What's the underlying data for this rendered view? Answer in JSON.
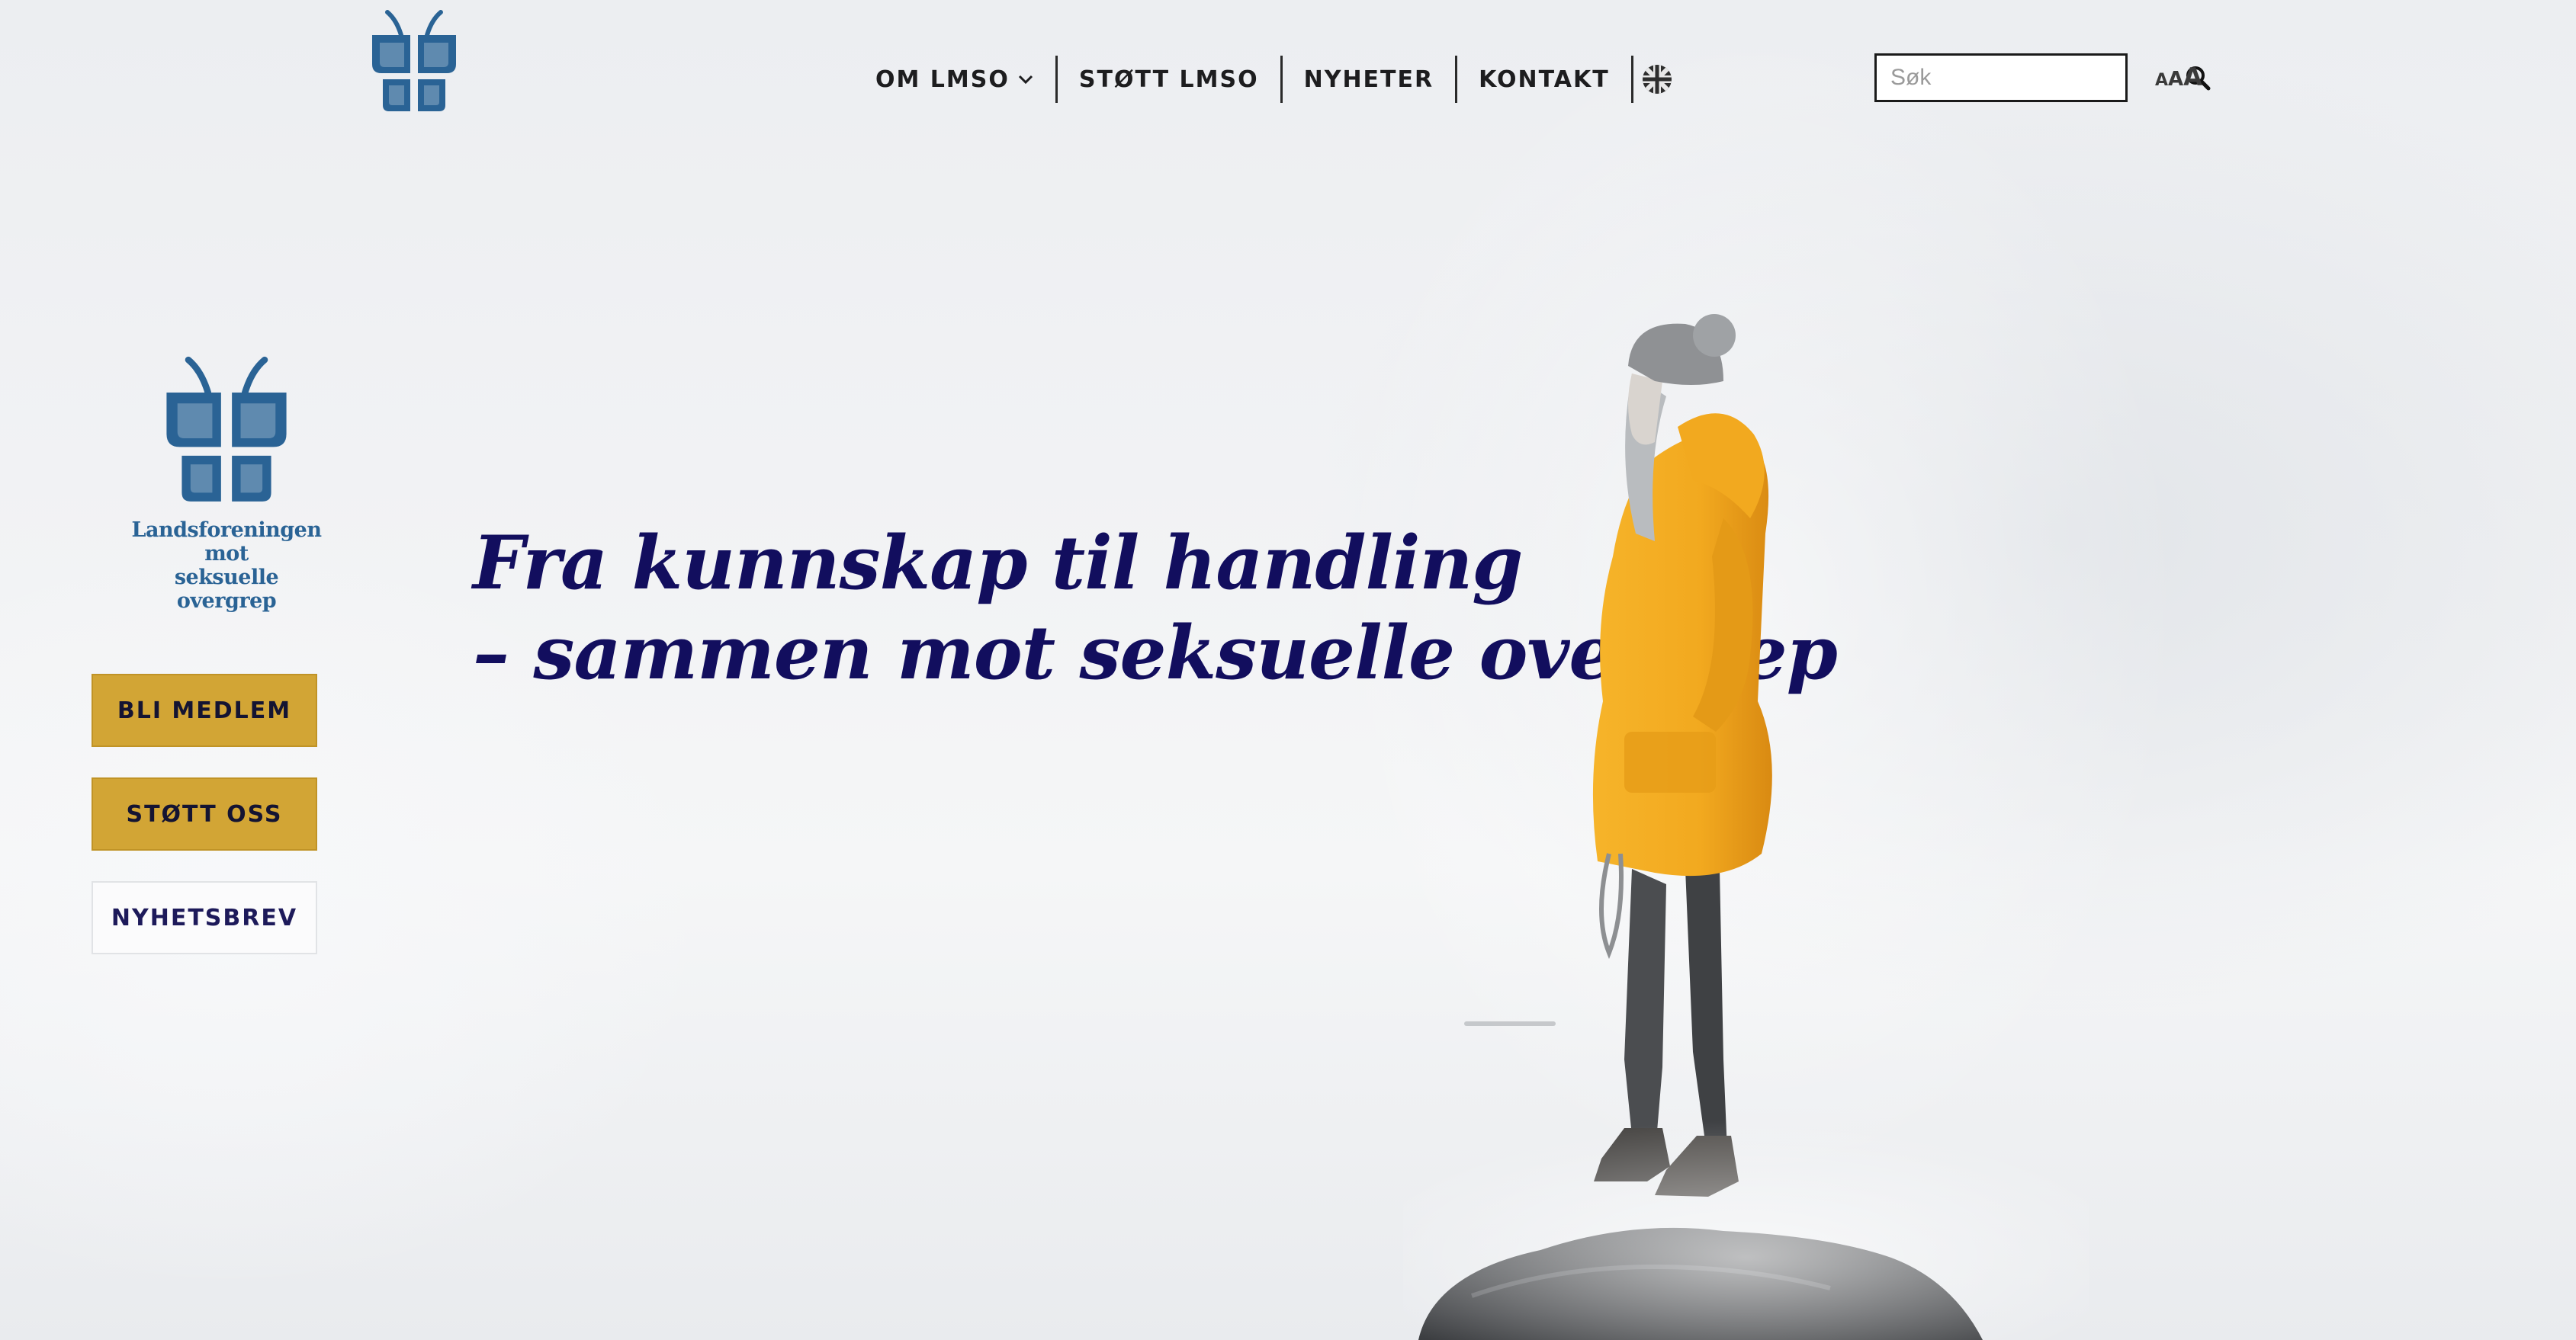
{
  "header": {
    "nav": [
      {
        "label": "OM LMSO",
        "has_dropdown": true
      },
      {
        "label": "STØTT LMSO"
      },
      {
        "label": "NYHETER"
      },
      {
        "label": "KONTAKT"
      }
    ],
    "language_icon": "uk-flag-icon",
    "search": {
      "placeholder": "Søk",
      "value": ""
    },
    "font_size_toggle": {
      "small": "A",
      "medium": "A",
      "large": "A"
    }
  },
  "sidebar": {
    "org_name_line1": "Landsforeningen mot",
    "org_name_line2": "seksuelle overgrep",
    "buttons": [
      {
        "label": "BLI MEDLEM"
      },
      {
        "label": "STØTT OSS"
      },
      {
        "label": "NYHETSBREV"
      }
    ]
  },
  "hero": {
    "line1": "Fra kunnskap til handling",
    "line2": "– sammen mot seksuelle overgrep"
  },
  "colors": {
    "brand_blue": "#2a6395",
    "heading_navy": "#120e5e",
    "button_gold": "#d2a535",
    "jacket_yellow": "#f2a91f"
  }
}
